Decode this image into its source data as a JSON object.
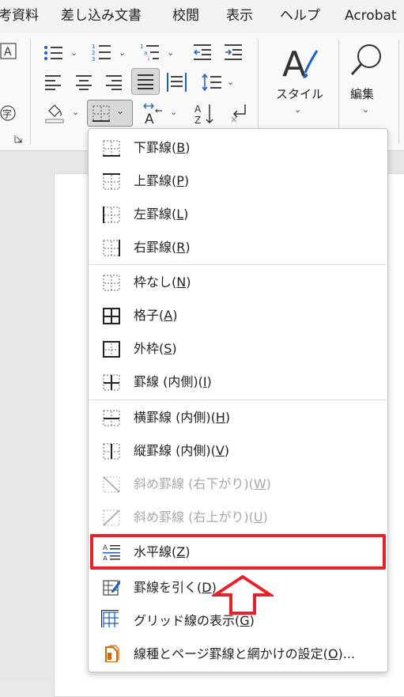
{
  "tabs": [
    "考資料",
    "差し込み文書",
    "校閲",
    "表示",
    "ヘルプ",
    "Acrobat"
  ],
  "ribbon": {
    "styles_label": "スタイル",
    "editing_label": "編集",
    "sort_label": "Z↓"
  },
  "border_menu": {
    "groups": [
      [
        {
          "label": "下罫線(",
          "key": "B",
          "tail": ")",
          "icon": "border-bottom-icon",
          "enabled": true
        },
        {
          "label": "上罫線(",
          "key": "P",
          "tail": ")",
          "icon": "border-top-icon",
          "enabled": true
        },
        {
          "label": "左罫線(",
          "key": "L",
          "tail": ")",
          "icon": "border-left-icon",
          "enabled": true
        },
        {
          "label": "右罫線(",
          "key": "R",
          "tail": ")",
          "icon": "border-right-icon",
          "enabled": true
        }
      ],
      [
        {
          "label": "枠なし(",
          "key": "N",
          "tail": ")",
          "icon": "no-border-icon",
          "enabled": true
        },
        {
          "label": "格子(",
          "key": "A",
          "tail": ")",
          "icon": "all-borders-icon",
          "enabled": true
        },
        {
          "label": "外枠(",
          "key": "S",
          "tail": ")",
          "icon": "outside-borders-icon",
          "enabled": true
        },
        {
          "label": "罫線 (内側)(",
          "key": "I",
          "tail": ")",
          "icon": "inside-borders-icon",
          "enabled": true
        }
      ],
      [
        {
          "label": "横罫線 (内側)(",
          "key": "H",
          "tail": ")",
          "icon": "inside-horizontal-border-icon",
          "enabled": true
        },
        {
          "label": "縦罫線 (内側)(",
          "key": "V",
          "tail": ")",
          "icon": "inside-vertical-border-icon",
          "enabled": true
        },
        {
          "label": "斜め罫線 (右下がり)(",
          "key": "W",
          "tail": ")",
          "icon": "diagonal-down-border-icon",
          "enabled": false
        },
        {
          "label": "斜め罫線 (右上がり)(",
          "key": "U",
          "tail": ")",
          "icon": "diagonal-up-border-icon",
          "enabled": false
        }
      ],
      [
        {
          "label": "水平線(",
          "key": "Z",
          "tail": ")",
          "icon": "horizontal-line-icon",
          "enabled": true
        },
        {
          "label": "罫線を引く(",
          "key": "D",
          "tail": ")",
          "icon": "draw-table-icon",
          "enabled": true
        },
        {
          "label": "グリッド線の表示(",
          "key": "G",
          "tail": ")",
          "icon": "view-gridlines-icon",
          "enabled": true
        },
        {
          "label": "線種とページ罫線と網かけの設定(",
          "key": "O",
          "tail": ")...",
          "icon": "borders-and-shading-icon",
          "enabled": true
        }
      ]
    ]
  },
  "colors": {
    "highlight": "#e8202a",
    "accent_blue": "#1f5fbf"
  }
}
